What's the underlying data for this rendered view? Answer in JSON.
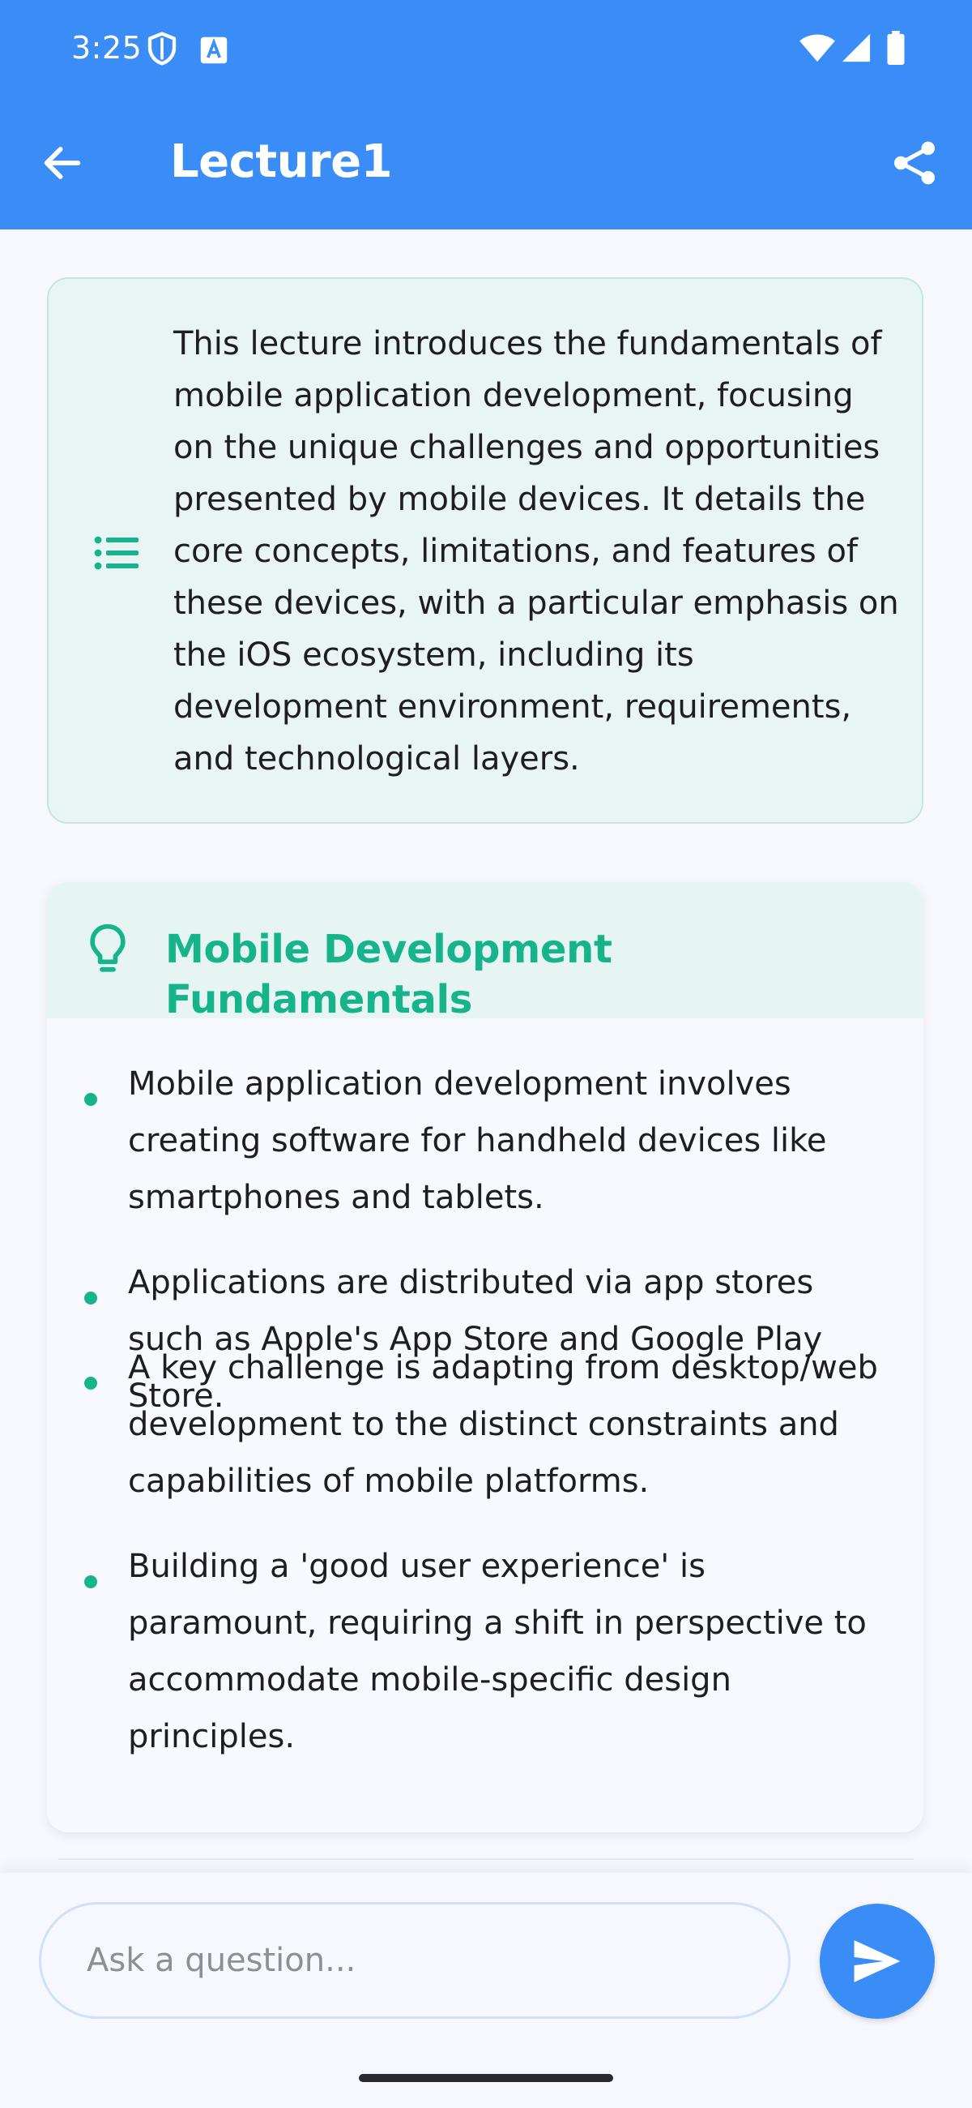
{
  "status_bar": {
    "time": "3:25",
    "icons": [
      "shield-icon",
      "accessibility-a-icon",
      "wifi-icon",
      "signal-icon",
      "battery-icon"
    ]
  },
  "app_bar": {
    "title": "Lecture1",
    "back_icon": "arrow-left-icon",
    "share_icon": "share-icon",
    "color": "#3a8cf6"
  },
  "summary": {
    "icon": "list-icon",
    "text": "This lecture introduces the fundamentals of mobile application development, focusing on the unique challenges and opportunities presented by mobile devices. It details the core concepts, limitations, and features of these devices, with a particular emphasis on the iOS ecosystem, including its development environment, requirements, and technological layers."
  },
  "section": {
    "icon": "lightbulb-icon",
    "title": "Mobile Development Fundamentals",
    "accent_color": "#17b38a",
    "bullets": [
      "Mobile application development involves creating software for handheld devices like smartphones and tablets.",
      "Applications are distributed via app stores such as Apple's App Store and Google Play Store.",
      "A key challenge is adapting from desktop/web development to the distinct constraints and capabilities of mobile platforms.",
      "Building a 'good user experience' is paramount, requiring a shift in perspective to accommodate mobile-specific design principles."
    ]
  },
  "input_bar": {
    "placeholder": "Ask a question...",
    "value": "",
    "send_icon": "send-icon"
  }
}
